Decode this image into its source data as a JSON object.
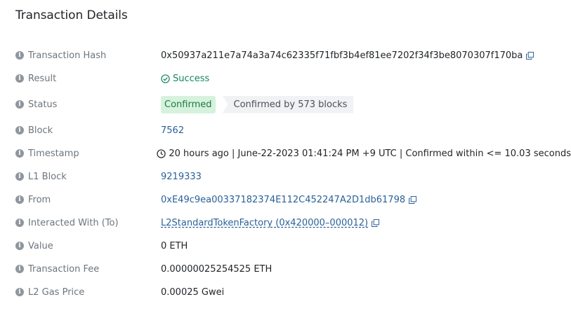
{
  "title": "Transaction Details",
  "rows": {
    "tx_hash": {
      "label": "Transaction Hash",
      "value": "0x50937a211e7a74a3a74c62335f71fbf3b4ef81ee7202f34f3be8070307f170ba"
    },
    "result": {
      "label": "Result",
      "value": "Success"
    },
    "status": {
      "label": "Status",
      "badge": "Confirmed",
      "blocks": "Confirmed by 573 blocks"
    },
    "block": {
      "label": "Block",
      "value": "7562"
    },
    "timestamp": {
      "label": "Timestamp",
      "value": "20 hours ago | June-22-2023 01:41:24 PM +9 UTC | Confirmed within <= 10.03 seconds"
    },
    "l1_block": {
      "label": "L1 Block",
      "value": "9219333"
    },
    "from": {
      "label": "From",
      "value": "0xE49c9ea00337182374E112C452247A2D1db61798"
    },
    "to": {
      "label": "Interacted With (To)",
      "value": "L2StandardTokenFactory (0x420000–000012)"
    },
    "value": {
      "label": "Value",
      "value": "0 ETH"
    },
    "fee": {
      "label": "Transaction Fee",
      "value": "0.00000025254525 ETH"
    },
    "gas_price": {
      "label": "L2 Gas Price",
      "value": "0.00025 Gwei"
    }
  },
  "icons": {
    "info": "info-icon",
    "copy": "copy-icon",
    "success": "check-circle-icon",
    "clock": "clock-icon"
  },
  "colors": {
    "link": "#2a6197",
    "success": "#15875a",
    "confirmed_bg": "#d6f2dd",
    "blocks_bg": "#f1f2f4"
  }
}
